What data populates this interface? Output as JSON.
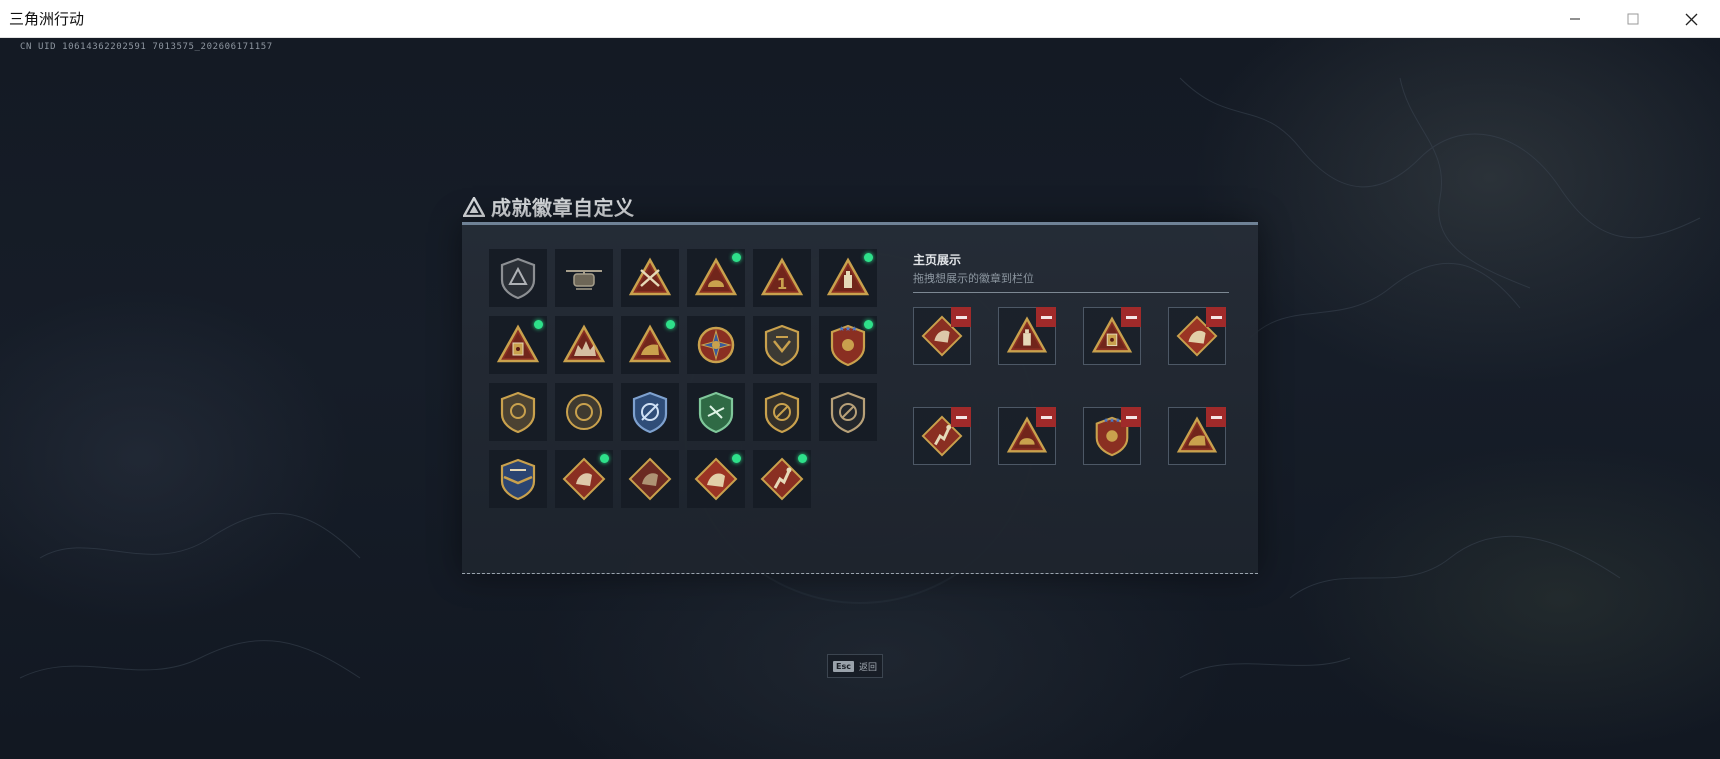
{
  "window": {
    "title": "三角洲行动",
    "controls": [
      "minimize",
      "maximize",
      "close"
    ]
  },
  "overlay": {
    "uid_text": "CN UID 10614362202591 7013575_202606171157"
  },
  "panel": {
    "title": "成就徽章自定义",
    "title_icon": "delta-triangle-icon",
    "badges": [
      {
        "icon": "shield-triangle-gray",
        "new": false
      },
      {
        "icon": "helicopter",
        "new": false
      },
      {
        "icon": "triangle-crossed-rifles",
        "new": false
      },
      {
        "icon": "triangle-helmet",
        "new": true
      },
      {
        "icon": "triangle-number-one",
        "new": false
      },
      {
        "icon": "triangle-bottle",
        "new": true
      },
      {
        "icon": "triangle-canister",
        "new": true
      },
      {
        "icon": "triangle-fortress",
        "new": false
      },
      {
        "icon": "triangle-dog",
        "new": true
      },
      {
        "icon": "star-medal",
        "new": false
      },
      {
        "icon": "shield-wings",
        "new": false
      },
      {
        "icon": "crest-stars",
        "new": true
      },
      {
        "icon": "shield-lion",
        "new": false
      },
      {
        "icon": "round-emblem",
        "new": false
      },
      {
        "icon": "blue-crest",
        "new": false
      },
      {
        "icon": "green-crest",
        "new": false
      },
      {
        "icon": "shield-knife-outline",
        "new": false
      },
      {
        "icon": "shield-knife-dark",
        "new": false
      },
      {
        "icon": "winged-crest",
        "new": false
      },
      {
        "icon": "diamond-dragon",
        "new": true
      },
      {
        "icon": "diamond-dragon-dark",
        "new": false
      },
      {
        "icon": "diamond-dragon-red",
        "new": true
      },
      {
        "icon": "diamond-runner",
        "new": true
      }
    ],
    "showcase": {
      "title": "主页展示",
      "subtitle": "拖拽想展示的徽章到栏位",
      "slots": [
        {
          "icon": "diamond-dragon"
        },
        {
          "icon": "triangle-bottle"
        },
        {
          "icon": "triangle-canister"
        },
        {
          "icon": "diamond-dragon-red"
        },
        {
          "icon": "diamond-runner"
        },
        {
          "icon": "triangle-helmet"
        },
        {
          "icon": "crest-stars"
        },
        {
          "icon": "triangle-dog"
        }
      ]
    }
  },
  "footer": {
    "esc_key": "Esc",
    "esc_label": "返回"
  },
  "colors": {
    "accent_new": "#2ee08a",
    "remove_button": "#a02a2a",
    "panel_top_border": "#6f8296",
    "badge_gold": "#c9a14d",
    "badge_red": "#8a2f22"
  }
}
